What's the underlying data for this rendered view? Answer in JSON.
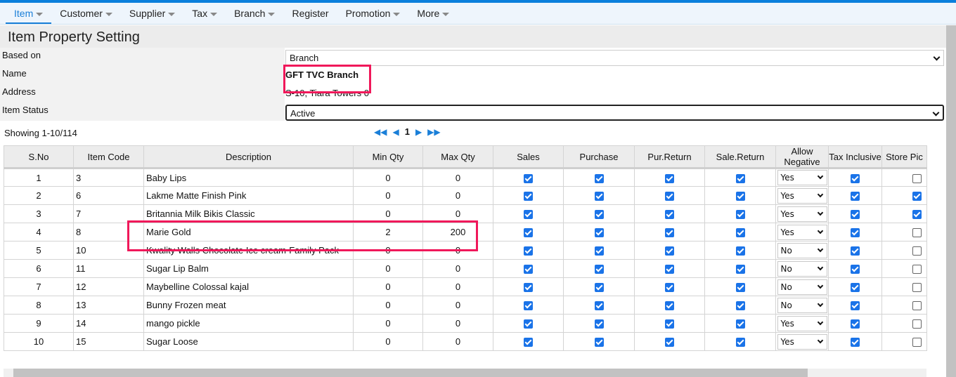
{
  "nav": [
    {
      "label": "Item",
      "caret": true,
      "active": true
    },
    {
      "label": "Customer",
      "caret": true
    },
    {
      "label": "Supplier",
      "caret": true
    },
    {
      "label": "Tax",
      "caret": true
    },
    {
      "label": "Branch",
      "caret": true
    },
    {
      "label": "Register",
      "caret": false
    },
    {
      "label": "Promotion",
      "caret": true
    },
    {
      "label": "More",
      "caret": true
    }
  ],
  "page_title": "Item Property Setting",
  "form": {
    "based_on_label": "Based on",
    "based_on_value": "Branch",
    "name_label": "Name",
    "name_value": "GFT TVC Branch",
    "address_label": "Address",
    "address_value": "S-10, Tiara Towers 0",
    "status_label": "Item Status",
    "status_value": "Active"
  },
  "showing": "Showing 1-10/114",
  "pager": {
    "page": "1"
  },
  "columns": [
    "S.No",
    "Item Code",
    "Description",
    "Min Qty",
    "Max Qty",
    "Sales",
    "Purchase",
    "Pur.Return",
    "Sale.Return",
    "Allow Negative",
    "Tax Inclusive",
    "Store Pic"
  ],
  "rows": [
    {
      "sno": "1",
      "code": "3",
      "desc": "Baby Lips",
      "min": "0",
      "max": "0",
      "sales": true,
      "purchase": true,
      "pur_return": true,
      "sale_return": true,
      "allow_negative": "Yes",
      "tax_inclusive": true,
      "store_pic": false
    },
    {
      "sno": "2",
      "code": "6",
      "desc": "Lakme Matte Finish Pink",
      "min": "0",
      "max": "0",
      "sales": true,
      "purchase": true,
      "pur_return": true,
      "sale_return": true,
      "allow_negative": "Yes",
      "tax_inclusive": true,
      "store_pic": true
    },
    {
      "sno": "3",
      "code": "7",
      "desc": "Britannia Milk Bikis Classic",
      "min": "0",
      "max": "0",
      "sales": true,
      "purchase": true,
      "pur_return": true,
      "sale_return": true,
      "allow_negative": "Yes",
      "tax_inclusive": true,
      "store_pic": true
    },
    {
      "sno": "4",
      "code": "8",
      "desc": "Marie Gold",
      "min": "2",
      "max": "200",
      "sales": true,
      "purchase": true,
      "pur_return": true,
      "sale_return": true,
      "allow_negative": "Yes",
      "tax_inclusive": true,
      "store_pic": false
    },
    {
      "sno": "5",
      "code": "10",
      "desc": "Kwality Walls Chocolate Ice cream-Family Pack",
      "min": "0",
      "max": "0",
      "sales": true,
      "purchase": true,
      "pur_return": true,
      "sale_return": true,
      "allow_negative": "No",
      "tax_inclusive": true,
      "store_pic": false
    },
    {
      "sno": "6",
      "code": "11",
      "desc": "Sugar Lip Balm",
      "min": "0",
      "max": "0",
      "sales": true,
      "purchase": true,
      "pur_return": true,
      "sale_return": true,
      "allow_negative": "No",
      "tax_inclusive": true,
      "store_pic": false
    },
    {
      "sno": "7",
      "code": "12",
      "desc": "Maybelline Colossal kajal",
      "min": "0",
      "max": "0",
      "sales": true,
      "purchase": true,
      "pur_return": true,
      "sale_return": true,
      "allow_negative": "No",
      "tax_inclusive": true,
      "store_pic": false
    },
    {
      "sno": "8",
      "code": "13",
      "desc": "Bunny Frozen meat",
      "min": "0",
      "max": "0",
      "sales": true,
      "purchase": true,
      "pur_return": true,
      "sale_return": true,
      "allow_negative": "No",
      "tax_inclusive": true,
      "store_pic": false
    },
    {
      "sno": "9",
      "code": "14",
      "desc": "mango pickle",
      "min": "0",
      "max": "0",
      "sales": true,
      "purchase": true,
      "pur_return": true,
      "sale_return": true,
      "allow_negative": "Yes",
      "tax_inclusive": true,
      "store_pic": false
    },
    {
      "sno": "10",
      "code": "15",
      "desc": "Sugar Loose",
      "min": "0",
      "max": "0",
      "sales": true,
      "purchase": true,
      "pur_return": true,
      "sale_return": true,
      "allow_negative": "Yes",
      "tax_inclusive": true,
      "store_pic": false
    }
  ],
  "colors": {
    "accent": "#1a7fd8",
    "checkbox": "#1a73e8",
    "highlight": "#f0185a"
  }
}
